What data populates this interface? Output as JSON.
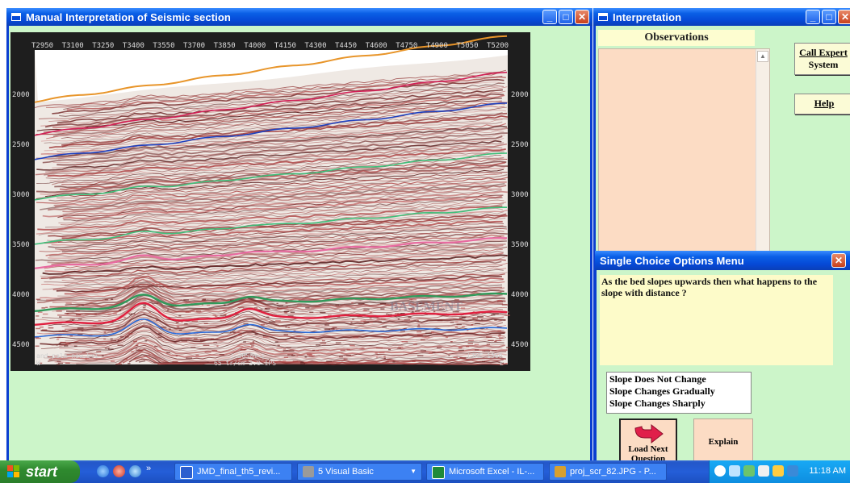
{
  "left_window": {
    "title": "Manual Interpretation of Seismic section",
    "buttons": [
      "minimize",
      "maximize",
      "close"
    ]
  },
  "seismic": {
    "top_labels": [
      "T2950",
      "T3100",
      "T3250",
      "T3400",
      "T3550",
      "T3700",
      "T3850",
      "T4000",
      "T4150",
      "T4300",
      "T4450",
      "T4600",
      "T4750",
      "T4900",
      "T5050",
      "T5200"
    ],
    "left_depths": [
      "2000",
      "2500",
      "3000",
      "3500",
      "4000",
      "4500"
    ],
    "right_depths": [
      "2000",
      "2500",
      "3000",
      "3500",
      "4000",
      "4500"
    ],
    "bottom_left": "and-palm-new.bri",
    "bottom_left2": "W",
    "bottom_center": "|~2050m~|",
    "bottom_center2": "65 tr/cm 3.0 IPS",
    "bottom_right": "LINE 1360",
    "bottom_right2": "E",
    "watermark": "BASEMENT"
  },
  "right_window": {
    "title": "Interpretation",
    "observations_label": "Observations",
    "call_expert_line1": "Call Expert",
    "call_expert_line2": "System",
    "help_label": "Help"
  },
  "dialog": {
    "title": "Single Choice Options Menu",
    "question": "As the bed slopes upwards then what happens to the slope with distance ?",
    "options": [
      "Slope Does Not Change",
      "Slope Changes Gradually",
      "Slope Changes Sharply"
    ],
    "load_next_line1": "Load Next",
    "load_next_line2": "Question",
    "explain_label": "Explain"
  },
  "taskbar": {
    "start_label": "start",
    "tasks": [
      {
        "label": "JMD_final_th5_revi...",
        "icon": "word-icon",
        "color": "#2b5fcf"
      },
      {
        "label": "5 Visual Basic",
        "icon": "vb-icon",
        "color": "#7a7a7a"
      },
      {
        "label": "Microsoft Excel - IL-...",
        "icon": "excel-icon",
        "color": "#1f8a3a"
      },
      {
        "label": "proj_scr_82.JPG - P...",
        "icon": "paint-icon",
        "color": "#d8a030"
      }
    ],
    "clock": "11:18 AM"
  }
}
